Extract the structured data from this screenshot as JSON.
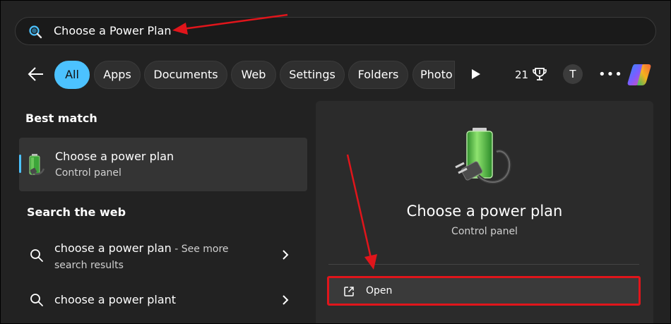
{
  "search": {
    "query": "Choose a Power Plan"
  },
  "filters": {
    "chips": [
      "All",
      "Apps",
      "Documents",
      "Web",
      "Settings",
      "Folders",
      "Photo"
    ],
    "reward_count": "21",
    "avatar_initial": "T",
    "more": "•••"
  },
  "best_match": {
    "heading": "Best match",
    "title": "Choose a power plan",
    "subtitle": "Control panel"
  },
  "web": {
    "heading": "Search the web",
    "items": [
      {
        "title": "choose a power plan",
        "see_more": " - See more",
        "subtitle": "search results"
      },
      {
        "title": "choose a power plant"
      }
    ]
  },
  "detail": {
    "title": "Choose a power plan",
    "subtitle": "Control panel",
    "open_label": "Open"
  },
  "colors": {
    "accent": "#4cc2ff",
    "annotation": "#e0151b"
  }
}
